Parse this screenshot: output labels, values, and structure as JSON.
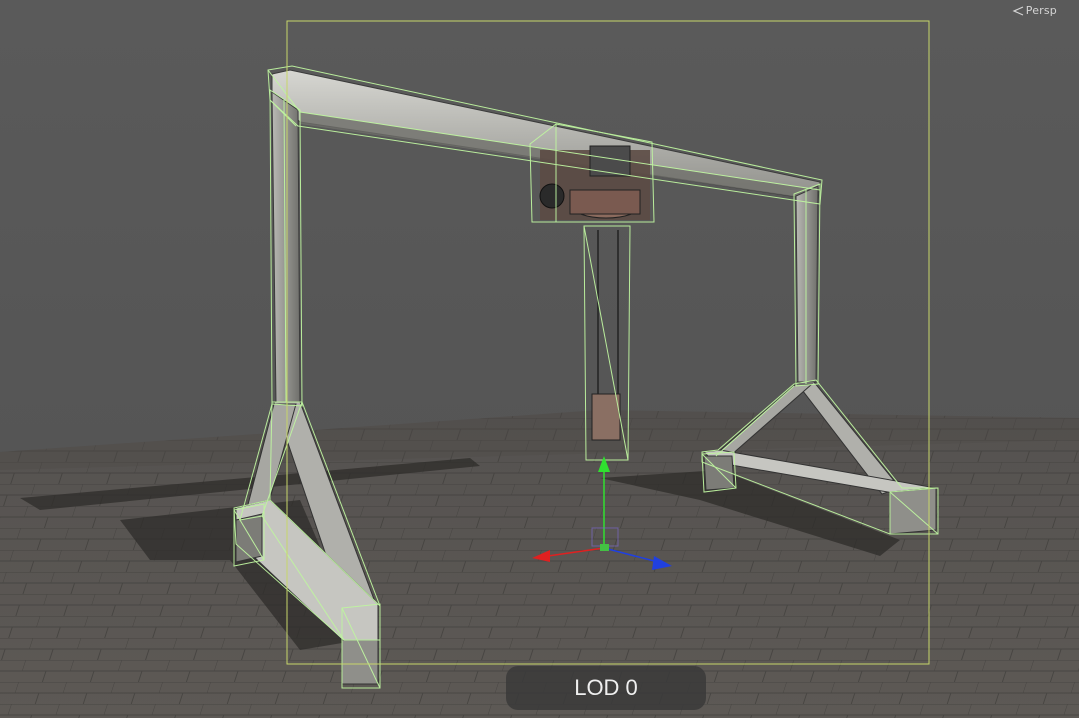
{
  "viewport": {
    "projection_label": "Persp",
    "lod_label": "LOD 0"
  },
  "icons": {
    "projection": "perspective-icon",
    "gizmo_x": "x-axis-arrow-icon",
    "gizmo_y": "y-axis-arrow-icon",
    "gizmo_z": "z-axis-arrow-icon"
  },
  "colors": {
    "background": "#595959",
    "floor": "#5b5855",
    "wireframe": "#bff5a0",
    "bounds": "#c7d66a",
    "axis_x": "#e02020",
    "axis_y": "#30e030",
    "axis_z": "#2040e0"
  }
}
